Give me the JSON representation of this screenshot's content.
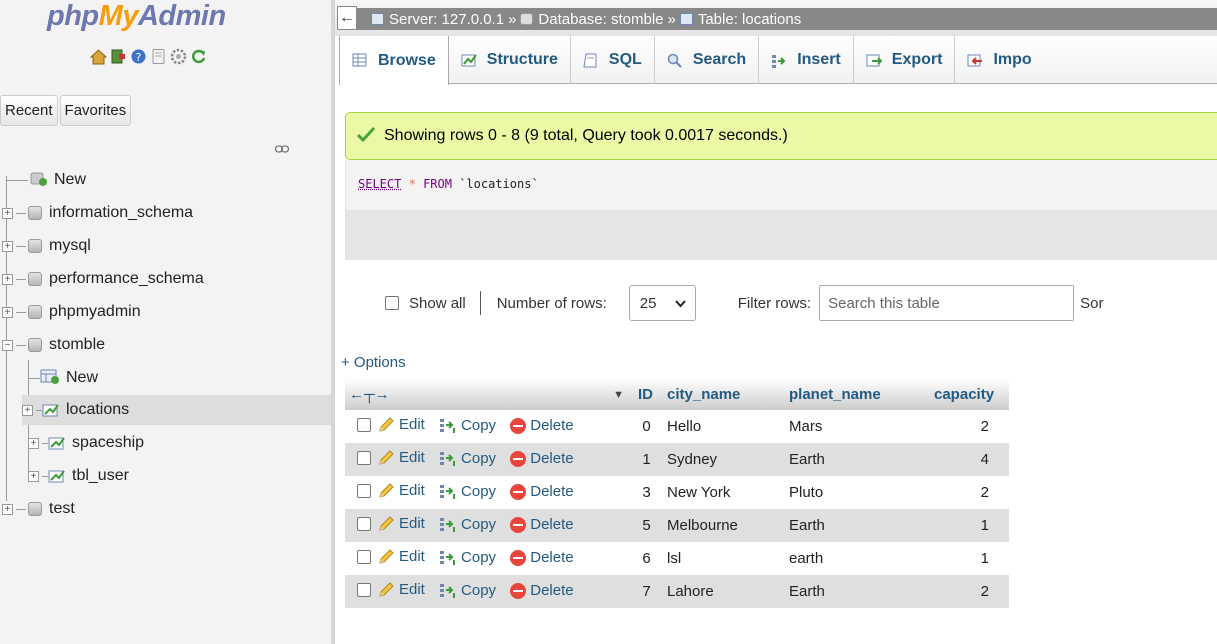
{
  "nav": {
    "logo": {
      "php": "php",
      "my": "My",
      "admin": "Admin"
    },
    "tabs": [
      "Recent",
      "Favorites"
    ],
    "tree": [
      {
        "label": "New",
        "level": 0,
        "type": "new"
      },
      {
        "label": "information_schema",
        "level": 0,
        "type": "db"
      },
      {
        "label": "mysql",
        "level": 0,
        "type": "db"
      },
      {
        "label": "performance_schema",
        "level": 0,
        "type": "db"
      },
      {
        "label": "phpmyadmin",
        "level": 0,
        "type": "db"
      },
      {
        "label": "stomble",
        "level": 0,
        "type": "db-open"
      },
      {
        "label": "New",
        "level": 1,
        "type": "new"
      },
      {
        "label": "locations",
        "level": 1,
        "type": "table",
        "selected": true
      },
      {
        "label": "spaceship",
        "level": 1,
        "type": "table"
      },
      {
        "label": "tbl_user",
        "level": 1,
        "type": "table"
      },
      {
        "label": "test",
        "level": 0,
        "type": "db"
      }
    ]
  },
  "breadcrumb": {
    "back": "←",
    "server_label": "Server: 127.0.0.1",
    "database_label": "Database: stomble",
    "table_label": "Table: locations",
    "sep": "»"
  },
  "tabs": {
    "browse": "Browse",
    "structure": "Structure",
    "sql": "SQL",
    "search": "Search",
    "insert": "Insert",
    "export": "Export",
    "import": "Impo"
  },
  "message": "Showing rows 0 - 8 (9 total, Query took 0.0017 seconds.)",
  "sql": {
    "select": "SELECT",
    "star": "*",
    "from": "FROM",
    "table": "`locations`"
  },
  "controls": {
    "show_all": "Show all",
    "number_of_rows_label": "Number of rows:",
    "number_of_rows_value": "25",
    "filter_label": "Filter rows:",
    "filter_placeholder": "Search this table",
    "sort_label": "Sor"
  },
  "options_link": "+ Options",
  "table": {
    "columns": [
      "ID",
      "city_name",
      "planet_name",
      "capacity"
    ],
    "actions": {
      "edit": "Edit",
      "copy": "Copy",
      "delete": "Delete"
    },
    "rows": [
      {
        "id": "0",
        "city": "Hello",
        "planet": "Mars",
        "capacity": "2"
      },
      {
        "id": "1",
        "city": "Sydney",
        "planet": "Earth",
        "capacity": "4"
      },
      {
        "id": "3",
        "city": "New York",
        "planet": "Pluto",
        "capacity": "2"
      },
      {
        "id": "5",
        "city": "Melbourne",
        "planet": "Earth",
        "capacity": "1"
      },
      {
        "id": "6",
        "city": "lsl",
        "planet": "earth",
        "capacity": "1"
      },
      {
        "id": "7",
        "city": "Lahore",
        "planet": "Earth",
        "capacity": "2"
      }
    ]
  },
  "colors": {
    "link": "#235a81",
    "success_bg": "#ebf8a4",
    "logo_blue": "#6c78af",
    "logo_orange": "#f89c0e",
    "row_alt": "#dfdfdf"
  }
}
